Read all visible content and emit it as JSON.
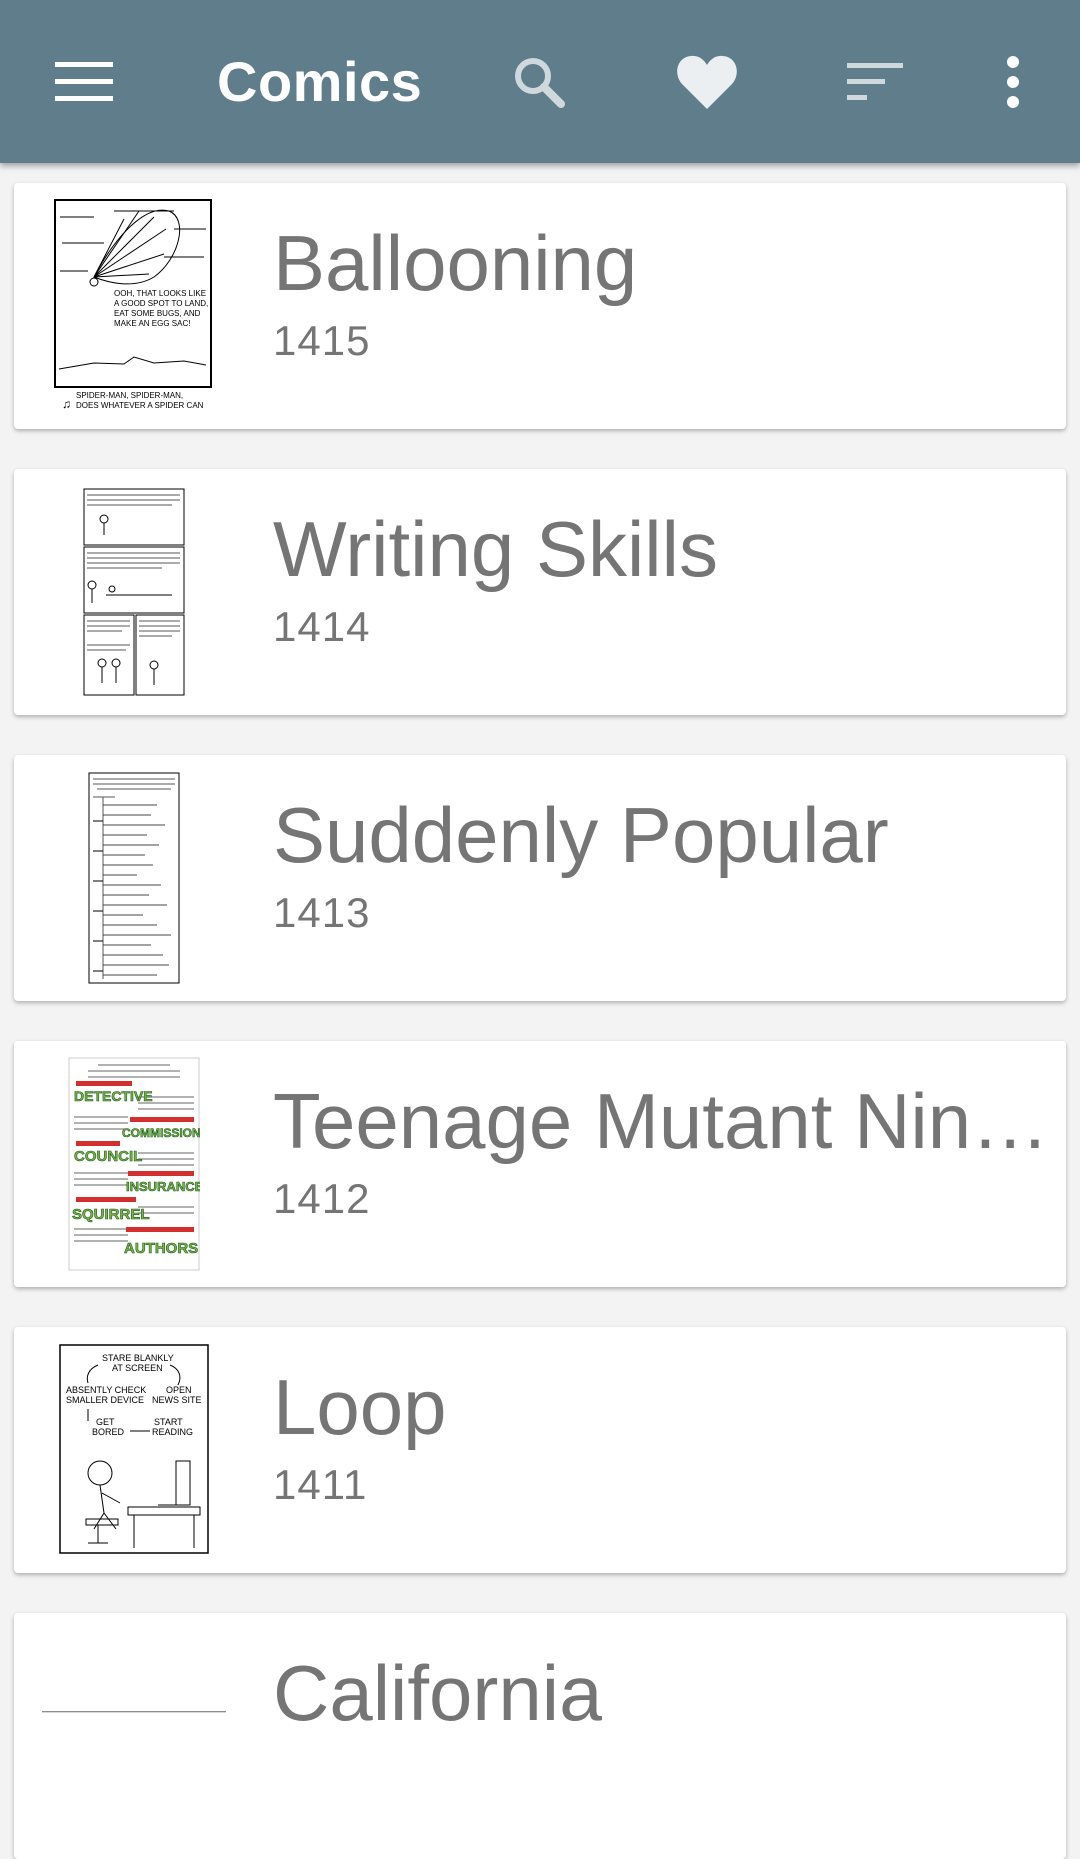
{
  "appbar": {
    "title": "Comics",
    "icons": [
      "menu-icon",
      "search-icon",
      "heart-icon",
      "sort-icon",
      "more-vert-icon"
    ],
    "background": "#607d8b"
  },
  "comics": [
    {
      "title": "Ballooning",
      "number": "1415"
    },
    {
      "title": "Writing Skills",
      "number": "1414"
    },
    {
      "title": "Suddenly Popular",
      "number": "1413"
    },
    {
      "title": "Teenage Mutant Nin…",
      "number": "1412"
    },
    {
      "title": "Loop",
      "number": "1411"
    },
    {
      "title": "California",
      "number": ""
    }
  ],
  "thumbnail_text": {
    "ballooning_speech": [
      "OOH, THAT LOOKS LIKE",
      "A GOOD SPOT TO LAND,",
      "EAT SOME BUGS, AND",
      "MAKE AN EGG SAC!"
    ],
    "ballooning_caption": [
      "SPIDER-MAN, SPIDER-MAN,",
      "DOES WHATEVER A SPIDER CAN"
    ],
    "tmnt_words": [
      "DETECTIVE",
      "COMMISSION",
      "COUNCIL",
      "INSURANCE",
      "SQUIRREL",
      "AUTHORS"
    ],
    "loop_labels": [
      "STARE BLANKLY",
      "AT SCREEN",
      "ABSENTLY CHECK",
      "SMALLER DEVICE",
      "OPEN",
      "NEWS SITE",
      "GET",
      "BORED",
      "START",
      "READING"
    ]
  }
}
